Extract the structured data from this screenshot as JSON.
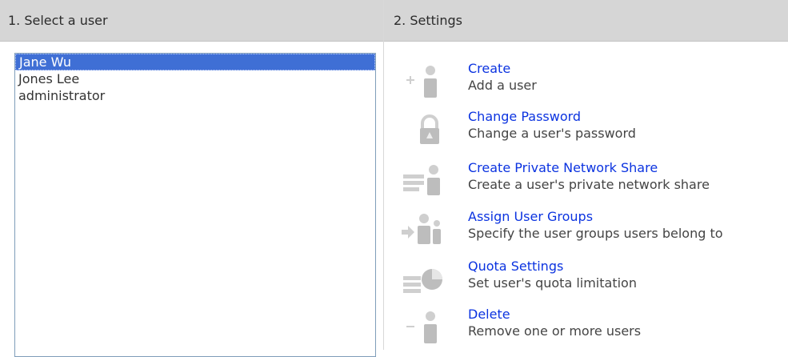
{
  "left_panel": {
    "header": "1. Select a user",
    "users": [
      {
        "name": "Jane Wu",
        "selected": true
      },
      {
        "name": "Jones Lee",
        "selected": false
      },
      {
        "name": "administrator",
        "selected": false
      }
    ]
  },
  "right_panel": {
    "header": "2. Settings",
    "actions": [
      {
        "icon": "add-user-icon",
        "title": "Create",
        "desc": "Add a user"
      },
      {
        "icon": "lock-icon",
        "title": "Change Password",
        "desc": "Change a user's password"
      },
      {
        "icon": "network-share-icon",
        "title": "Create Private Network Share",
        "desc": "Create a user's private network share"
      },
      {
        "icon": "user-groups-icon",
        "title": "Assign User Groups",
        "desc": "Specify the user groups users belong to"
      },
      {
        "icon": "quota-pie-icon",
        "title": "Quota Settings",
        "desc": "Set user's quota limitation"
      },
      {
        "icon": "remove-user-icon",
        "title": "Delete",
        "desc": "Remove one or more users"
      }
    ]
  },
  "colors": {
    "header_bg": "#d6d6d6",
    "selection": "#3f6fd5",
    "link": "#0b33e0",
    "icon": "#cfcfcf"
  }
}
